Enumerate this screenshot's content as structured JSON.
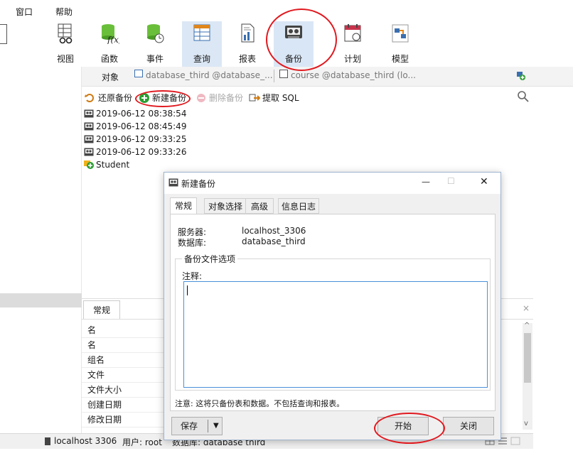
{
  "menu": [
    "窗口",
    "帮助"
  ],
  "toolbar": {
    "items": [
      {
        "label": "视图",
        "icon": "view-icon"
      },
      {
        "label": "函数",
        "icon": "function-icon"
      },
      {
        "label": "事件",
        "icon": "event-icon"
      },
      {
        "label": "查询",
        "icon": "query-icon"
      },
      {
        "label": "报表",
        "icon": "report-icon"
      },
      {
        "label": "备份",
        "icon": "backup-icon"
      },
      {
        "label": "计划",
        "icon": "schedule-icon"
      },
      {
        "label": "模型",
        "icon": "model-icon"
      }
    ],
    "active": "备份"
  },
  "object_bar": {
    "label": "对象",
    "tabs": [
      "database_third @database_...",
      "course @database_third (lo..."
    ]
  },
  "backup_toolbar": {
    "restore": "还原备份",
    "new": "新建备份",
    "delete": "删除备份",
    "extract": "提取 SQL"
  },
  "backups": [
    "2019-06-12 08:38:54",
    "2019-06-12 08:45:49",
    "2019-06-12 09:33:25",
    "2019-06-12 09:33:26",
    "Student"
  ],
  "info_panel": {
    "tab": "常规",
    "close": "×",
    "rows": [
      "名",
      "名",
      "组名",
      "文件",
      "文件大小",
      "创建日期",
      "修改日期"
    ]
  },
  "status": {
    "connection": "localhost 3306",
    "user": "用户: root",
    "database": "数据库: database third"
  },
  "dialog": {
    "title": "新建备份",
    "tabs": [
      "常规",
      "对象选择",
      "高级",
      "信息日志"
    ],
    "server_label": "服务器:",
    "server_value": "localhost_3306",
    "db_label": "数据库:",
    "db_value": "database_third",
    "group_label": "备份文件选项",
    "comment_label": "注释:",
    "comment_value": "",
    "note": "注意: 这将只备份表和数据。不包括查询和报表。",
    "save": "保存",
    "start": "开始",
    "close": "关闭",
    "minimize": "—",
    "maximize": "☐",
    "close_x": "✕"
  },
  "colors": {
    "annotation": "#e0191f",
    "active_tool": "#d9e6f5",
    "accent": "#0078d7"
  }
}
